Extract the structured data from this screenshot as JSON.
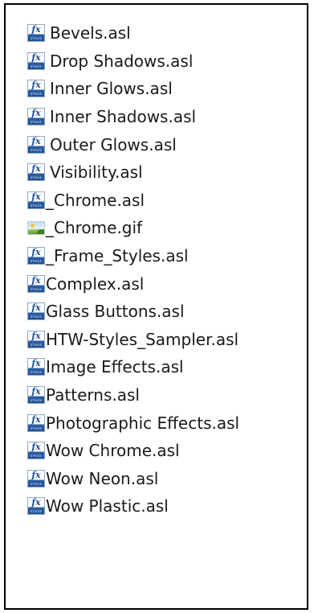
{
  "files": [
    {
      "name": "Bevels.asl",
      "icon": "photoshop-styles-file-icon",
      "icon_text": "fx",
      "icon_subtext": "STYLES"
    },
    {
      "name": "Drop Shadows.asl",
      "icon": "photoshop-styles-file-icon",
      "icon_text": "fx",
      "icon_subtext": "STYLES"
    },
    {
      "name": "Inner Glows.asl",
      "icon": "photoshop-styles-file-icon",
      "icon_text": "fx",
      "icon_subtext": "STYLES"
    },
    {
      "name": "Inner Shadows.asl",
      "icon": "photoshop-styles-file-icon",
      "icon_text": "fx",
      "icon_subtext": "STYLES"
    },
    {
      "name": "Outer Glows.asl",
      "icon": "photoshop-styles-file-icon",
      "icon_text": "fx",
      "icon_subtext": "STYLES"
    },
    {
      "name": "Visibility.asl",
      "icon": "photoshop-styles-file-icon",
      "icon_text": "fx",
      "icon_subtext": "STYLES"
    },
    {
      "name": "_Chrome.asl",
      "icon": "photoshop-styles-file-icon",
      "icon_text": "fx",
      "icon_subtext": "STYLES"
    },
    {
      "name": "_Chrome.gif",
      "icon": "image-file-icon"
    },
    {
      "name": "_Frame_Styles.asl",
      "icon": "photoshop-styles-file-icon",
      "icon_text": "fx",
      "icon_subtext": "STYLES"
    },
    {
      "name": "Complex.asl",
      "icon": "photoshop-styles-file-icon",
      "icon_text": "fx",
      "icon_subtext": "STYLES"
    },
    {
      "name": "Glass Buttons.asl",
      "icon": "photoshop-styles-file-icon",
      "icon_text": "fx",
      "icon_subtext": "STYLES"
    },
    {
      "name": "HTW-Styles_Sampler.asl",
      "icon": "photoshop-styles-file-icon",
      "icon_text": "fx",
      "icon_subtext": "STYLES"
    },
    {
      "name": "Image Effects.asl",
      "icon": "photoshop-styles-file-icon",
      "icon_text": "fx",
      "icon_subtext": "STYLES"
    },
    {
      "name": "Patterns.asl",
      "icon": "photoshop-styles-file-icon",
      "icon_text": "fx",
      "icon_subtext": "STYLES"
    },
    {
      "name": "Photographic Effects.asl",
      "icon": "photoshop-styles-file-icon",
      "icon_text": "fx",
      "icon_subtext": "STYLES"
    },
    {
      "name": "Wow Chrome.asl",
      "icon": "photoshop-styles-file-icon",
      "icon_text": "fx",
      "icon_subtext": "STYLES"
    },
    {
      "name": "Wow Neon.asl",
      "icon": "photoshop-styles-file-icon",
      "icon_text": "fx",
      "icon_subtext": "STYLES"
    },
    {
      "name": "Wow Plastic.asl",
      "icon": "photoshop-styles-file-icon",
      "icon_text": "fx",
      "icon_subtext": "STYLES"
    }
  ],
  "colors": {
    "border": "#000000",
    "background": "#ffffff",
    "text": "#1a1a1a",
    "styles_icon_blue": "#1f4f96"
  }
}
